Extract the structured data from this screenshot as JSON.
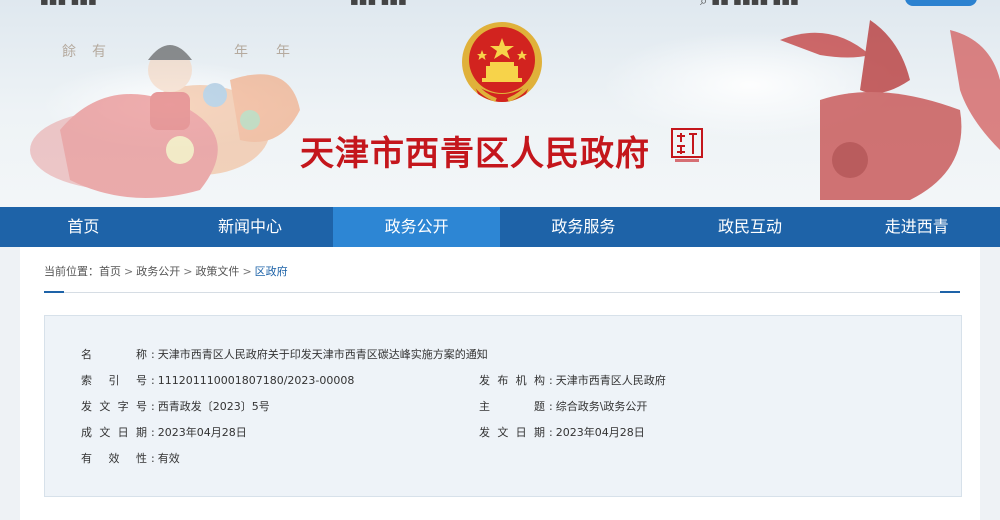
{
  "site": {
    "title": "天津市西青区人民政府"
  },
  "nav": {
    "items": [
      {
        "label": "首页"
      },
      {
        "label": "新闻中心"
      },
      {
        "label": "政务公开"
      },
      {
        "label": "政务服务"
      },
      {
        "label": "政民互动"
      },
      {
        "label": "走进西青"
      }
    ],
    "active_index": 2
  },
  "breadcrumb": {
    "prefix": "当前位置：",
    "items": [
      "首页",
      "政务公开",
      "政策文件",
      "区政府"
    ]
  },
  "document": {
    "name": {
      "label": "名　　称",
      "value": "天津市西青区人民政府关于印发天津市西青区碳达峰实施方案的通知"
    },
    "index_no": {
      "label": "索 引 号",
      "value": "111201110001807180/2023-00008"
    },
    "issuer": {
      "label": "发布机构",
      "value": "天津市西青区人民政府"
    },
    "doc_no": {
      "label": "发文字号",
      "value": "西青政发〔2023〕5号"
    },
    "subject": {
      "label": "主　　题",
      "value": "综合政务\\政务公开"
    },
    "written_date": {
      "label": "成文日期",
      "value": "2023年04月28日"
    },
    "publish_date": {
      "label": "发文日期",
      "value": "2023年04月28日"
    },
    "validity": {
      "label": "有 效 性",
      "value": "有效"
    }
  },
  "colors": {
    "nav_bg": "#1e63a8",
    "nav_active": "#2d86d4",
    "title_red": "#c4161c",
    "info_bg": "#eef3f8"
  },
  "icons": {
    "emblem": "national-emblem-icon",
    "seal": "seal-stamp-icon"
  }
}
